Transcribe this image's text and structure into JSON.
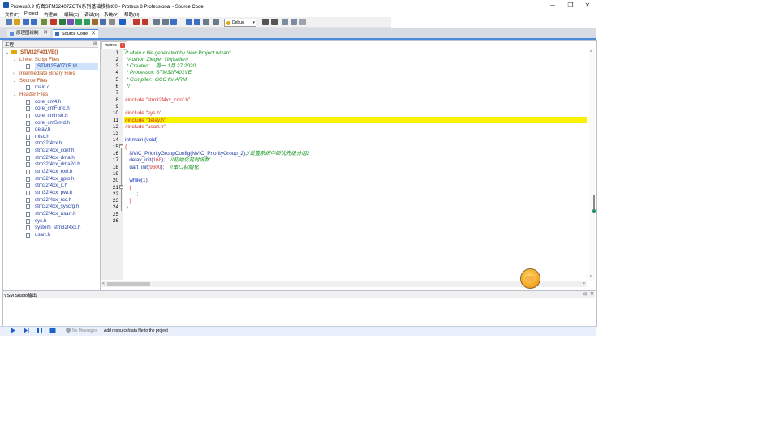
{
  "window": {
    "title": "Proteus8.9 仿真STM32407ZGT6系列基础模拟t00 - Proteus 8 Professional - Source Code",
    "controls": {
      "minimize": "─",
      "restore": "❐",
      "close": "✕"
    }
  },
  "menu": [
    "文件(F)",
    "Project",
    "构建(B)",
    "编辑(E)",
    "调试(D)",
    "系统(Y)",
    "帮助(H)"
  ],
  "toolbar": {
    "mode_select": "Debug",
    "icons": [
      "new-file-icon",
      "open-folder-icon",
      "save-icon",
      "save-all-icon",
      "import-icon",
      "close-project-icon",
      "home-icon",
      "schematic-icon",
      "pcb-icon",
      "3d-icon",
      "gerber-icon",
      "bom-icon",
      "notes-icon",
      "help-icon",
      "cut-icon",
      "delete-icon",
      "copy-icon",
      "paste-icon",
      "find-icon",
      "build-icon",
      "rebuild-icon",
      "clean-icon",
      "settings-icon",
      "undo-icon",
      "redo-icon",
      "indent-icon",
      "outdent-icon",
      "comment-icon"
    ]
  },
  "tabs": [
    {
      "label": "原理图绘制",
      "active": false
    },
    {
      "label": "Source Code",
      "active": true
    }
  ],
  "project_panel": {
    "title": "工程",
    "pin": "⊞",
    "tree": [
      {
        "label": "STM32F401VE()",
        "level": 0,
        "type": "root",
        "expanded": true
      },
      {
        "label": "Linker Script Files",
        "level": 1,
        "type": "folder",
        "expanded": true
      },
      {
        "label": "STM32F407XE.ld",
        "level": 2,
        "type": "file",
        "selected": true
      },
      {
        "label": "Intermediate Binary Files",
        "level": 1,
        "type": "folder",
        "expanded": false
      },
      {
        "label": "Source Files",
        "level": 1,
        "type": "folder",
        "expanded": true
      },
      {
        "label": "main.c",
        "level": 2,
        "type": "file"
      },
      {
        "label": "Header Files",
        "level": 1,
        "type": "folder",
        "expanded": true
      },
      {
        "label": "core_cm4.h",
        "level": 2,
        "type": "file"
      },
      {
        "label": "core_cmFunc.h",
        "level": 2,
        "type": "file"
      },
      {
        "label": "core_cmInstr.h",
        "level": 2,
        "type": "file"
      },
      {
        "label": "core_cmSimd.h",
        "level": 2,
        "type": "file"
      },
      {
        "label": "delay.h",
        "level": 2,
        "type": "file"
      },
      {
        "label": "misc.h",
        "level": 2,
        "type": "file"
      },
      {
        "label": "stm32f4xx.h",
        "level": 2,
        "type": "file"
      },
      {
        "label": "stm32f4xx_conf.h",
        "level": 2,
        "type": "file"
      },
      {
        "label": "stm32f4xx_dma.h",
        "level": 2,
        "type": "file"
      },
      {
        "label": "stm32f4xx_dma2d.h",
        "level": 2,
        "type": "file"
      },
      {
        "label": "stm32f4xx_exti.h",
        "level": 2,
        "type": "file"
      },
      {
        "label": "stm32f4xx_gpio.h",
        "level": 2,
        "type": "file"
      },
      {
        "label": "stm32f4xx_it.h",
        "level": 2,
        "type": "file"
      },
      {
        "label": "stm32f4xx_pwr.h",
        "level": 2,
        "type": "file"
      },
      {
        "label": "stm32f4xx_rcc.h",
        "level": 2,
        "type": "file"
      },
      {
        "label": "stm32f4xx_syscfg.h",
        "level": 2,
        "type": "file"
      },
      {
        "label": "stm32f4xx_usart.h",
        "level": 2,
        "type": "file"
      },
      {
        "label": "sys.h",
        "level": 2,
        "type": "file"
      },
      {
        "label": "system_stm32f4xx.h",
        "level": 2,
        "type": "file"
      },
      {
        "label": "usart.h",
        "level": 2,
        "type": "file"
      }
    ]
  },
  "editor": {
    "tab_label": "main.c",
    "tab_close": "×",
    "highlighted_line": 11,
    "lines": [
      {
        "n": "1",
        "parts": [
          {
            "t": "/* Main.c file generated by New Project wizard",
            "c": "cmt"
          }
        ]
      },
      {
        "n": "2",
        "parts": [
          {
            "t": " *Author: Ziegler Yin(kailen)",
            "c": "cmt"
          }
        ]
      },
      {
        "n": "3",
        "parts": [
          {
            "t": " * Created:    周一 1月 27 2020",
            "c": "cmt"
          }
        ]
      },
      {
        "n": "4",
        "parts": [
          {
            "t": " * Processor: STM32F401VE",
            "c": "cmt"
          }
        ]
      },
      {
        "n": "5",
        "parts": [
          {
            "t": " * Compiler:  GCC for ARM",
            "c": "cmt"
          }
        ]
      },
      {
        "n": "6",
        "parts": [
          {
            "t": " */",
            "c": "cmt"
          }
        ]
      },
      {
        "n": "7",
        "parts": []
      },
      {
        "n": "8",
        "parts": [
          {
            "t": "#include \"stm32f4xx_conf.h\"",
            "c": "pre"
          }
        ]
      },
      {
        "n": "9",
        "parts": []
      },
      {
        "n": "10",
        "parts": [
          {
            "t": "#include \"sys.h\"",
            "c": "pre"
          }
        ]
      },
      {
        "n": "11",
        "parts": [
          {
            "t": "#include \"delay.h\"",
            "c": "pre"
          }
        ]
      },
      {
        "n": "12",
        "parts": [
          {
            "t": "#include \"usart.h\"",
            "c": "pre"
          }
        ]
      },
      {
        "n": "13",
        "parts": []
      },
      {
        "n": "14",
        "parts": [
          {
            "t": "int",
            "c": "kw"
          },
          {
            "t": " main ",
            "c": "fn"
          },
          {
            "t": "(void)",
            "c": "kw"
          }
        ]
      },
      {
        "n": "15",
        "parts": [
          {
            "t": "{",
            "c": "pre"
          }
        ]
      },
      {
        "n": "16",
        "parts": [
          {
            "t": "   NVIC_PriorityGroupConfig(NVIC_PriorityGroup_2);",
            "c": "fn"
          },
          {
            "t": "//设置系统中断优先级分组2",
            "c": "cmt"
          }
        ]
      },
      {
        "n": "17",
        "parts": [
          {
            "t": "   delay_init(",
            "c": "fn"
          },
          {
            "t": "168",
            "c": "num"
          },
          {
            "t": ");    ",
            "c": "fn"
          },
          {
            "t": "//初始化延时函数",
            "c": "cmt"
          }
        ]
      },
      {
        "n": "18",
        "parts": [
          {
            "t": "   uart_init(",
            "c": "fn"
          },
          {
            "t": "9600",
            "c": "num"
          },
          {
            "t": ");    ",
            "c": "fn"
          },
          {
            "t": "//串口初始化",
            "c": "cmt"
          }
        ]
      },
      {
        "n": "19",
        "parts": []
      },
      {
        "n": "20",
        "parts": [
          {
            "t": "   while(",
            "c": "kw"
          },
          {
            "t": "1",
            "c": "num"
          },
          {
            "t": ")",
            "c": "kw"
          }
        ]
      },
      {
        "n": "21",
        "parts": [
          {
            "t": "   {",
            "c": "pre"
          }
        ]
      },
      {
        "n": "22",
        "parts": [
          {
            "t": "        ;",
            "c": "plain"
          }
        ]
      },
      {
        "n": "23",
        "parts": [
          {
            "t": "   }",
            "c": "pre"
          }
        ]
      },
      {
        "n": "24",
        "parts": [
          {
            "t": " }",
            "c": "pre"
          }
        ]
      },
      {
        "n": "25",
        "parts": []
      },
      {
        "n": "26",
        "parts": []
      }
    ],
    "scroll_left": "<",
    "scroll_right": ">",
    "scroll_up": "^",
    "scroll_down": "v"
  },
  "output_panel": {
    "title": "VSM Studio输出",
    "pin": "⊞",
    "close": "✕"
  },
  "status": {
    "messages": "No Messages",
    "text": "Add resource/data file to the project"
  }
}
